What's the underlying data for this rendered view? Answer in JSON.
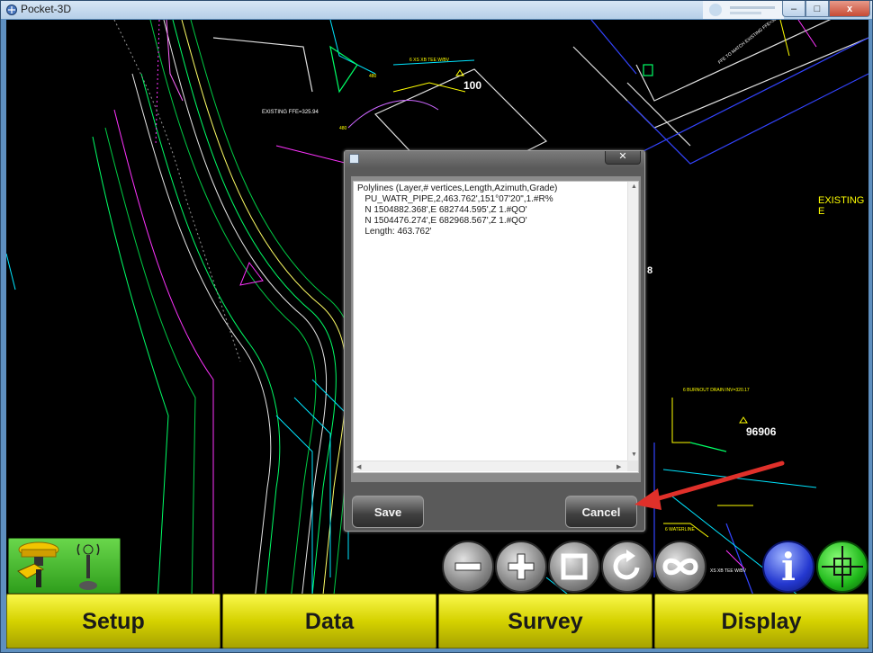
{
  "window": {
    "title": "Pocket-3D",
    "close_symbol": "x",
    "max_symbol": "□",
    "min_symbol": "–",
    "background_app_hint": ""
  },
  "cad": {
    "labels": {
      "point_100": "100",
      "point_96906": "96906",
      "existing_e": "EXISTING E",
      "existing_ffe": "EXISTING FFE=325.94",
      "number_8": "8",
      "label_480": "480",
      "label_480b": "480",
      "ffe_match": "FFE TO MATCH EXISTING FFE=325.94",
      "xs_tee_1": "6 XS XB TEE W/BV",
      "burnout": "6 BURNOUT DRAIN INV=320.17",
      "waterline": "6 WATERLINE",
      "xs_tee_2": "XS XB TEE W/BV"
    },
    "colors": {
      "background": "#000000",
      "yellow": "#ffff00",
      "green": "#00ff66",
      "cyan": "#00ffff",
      "magenta": "#ff33ff",
      "blue": "#3333ff",
      "white": "#ffffff"
    }
  },
  "dialog": {
    "title": "",
    "close_symbol": "✕",
    "text": "Polylines (Layer,# vertices,Length,Azimuth,Grade)\n   PU_WATR_PIPE,2,463.762',151°07'20\",1.#R%\n   N 1504882.368',E 682744.595',Z 1.#QO'\n   N 1504476.274',E 682968.567',Z 1.#QO'\n   Length: 463.762'",
    "save_label": "Save",
    "cancel_label": "Cancel",
    "scroll_up": "▲",
    "scroll_down": "▼",
    "scroll_left": "◀",
    "scroll_right": "▶"
  },
  "annotation": {
    "arrow_color": "#e0302a"
  },
  "toolbar": {
    "zoom_out": "zoom-out-icon",
    "zoom_in": "zoom-in-icon",
    "zoom_window": "zoom-window-icon",
    "refresh": "refresh-icon",
    "zoom_extents": "infinity-icon",
    "info": "i",
    "target": "crosshair-icon"
  },
  "tabs": [
    "Setup",
    "Data",
    "Survey",
    "Display"
  ]
}
